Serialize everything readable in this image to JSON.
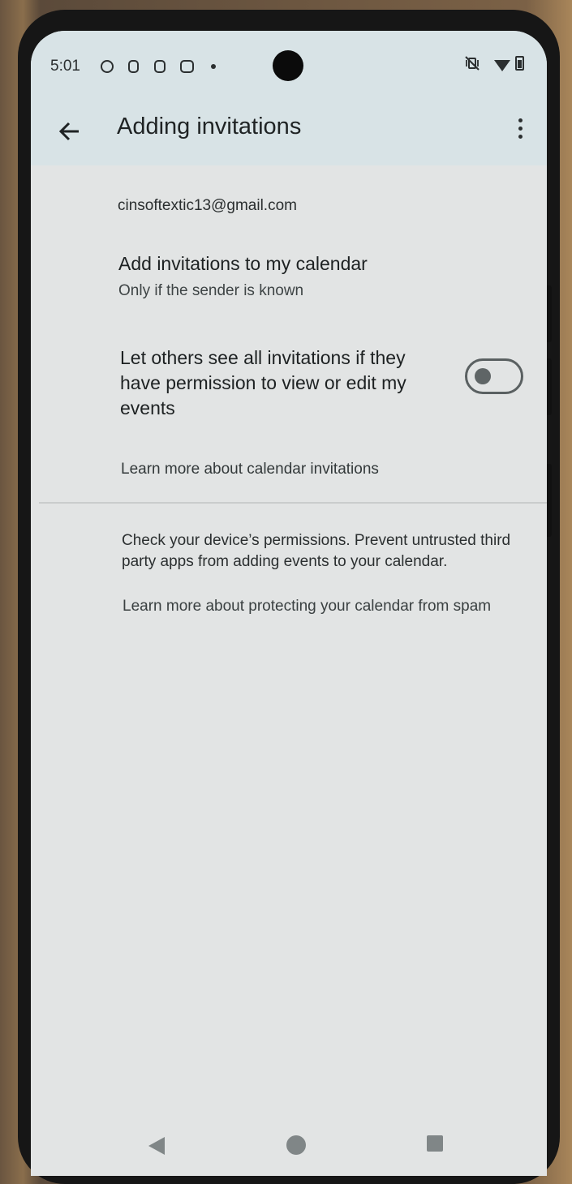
{
  "status_bar": {
    "time": "5:01",
    "left_icons": [
      "app-notification-icon",
      "sim-icon",
      "clipboard-icon",
      "message-icon",
      "dot-icon"
    ],
    "right_icons": [
      "vibrate-off-icon",
      "wifi-icon",
      "battery-icon"
    ]
  },
  "app_bar": {
    "title": "Adding invitations",
    "back_icon": "arrow-left-icon",
    "menu_icon": "more-vert-icon"
  },
  "content": {
    "account": "cinsoftextic13@gmail.com",
    "add_invitations": {
      "title": "Add invitations to my calendar",
      "value": "Only if the sender is known"
    },
    "let_others": {
      "label": "Let others see all invitations if they have permission to view or edit my events",
      "enabled": false
    },
    "learn_more_invitations": "Learn more about calendar invitations",
    "device_permissions_info": "Check your device’s permissions. Prevent untrusted third party apps from adding events to your calendar.",
    "learn_more_spam": "Learn more about protecting your calendar from spam"
  },
  "nav_bar": {
    "buttons": [
      "back-triangle-icon",
      "home-circle-icon",
      "recents-square-icon"
    ]
  },
  "colors": {
    "app_bar_bg": "#d8e3e6",
    "screen_bg": "#e2e4e4",
    "text_primary": "#1d2122",
    "toggle_off": "#5f6566"
  }
}
